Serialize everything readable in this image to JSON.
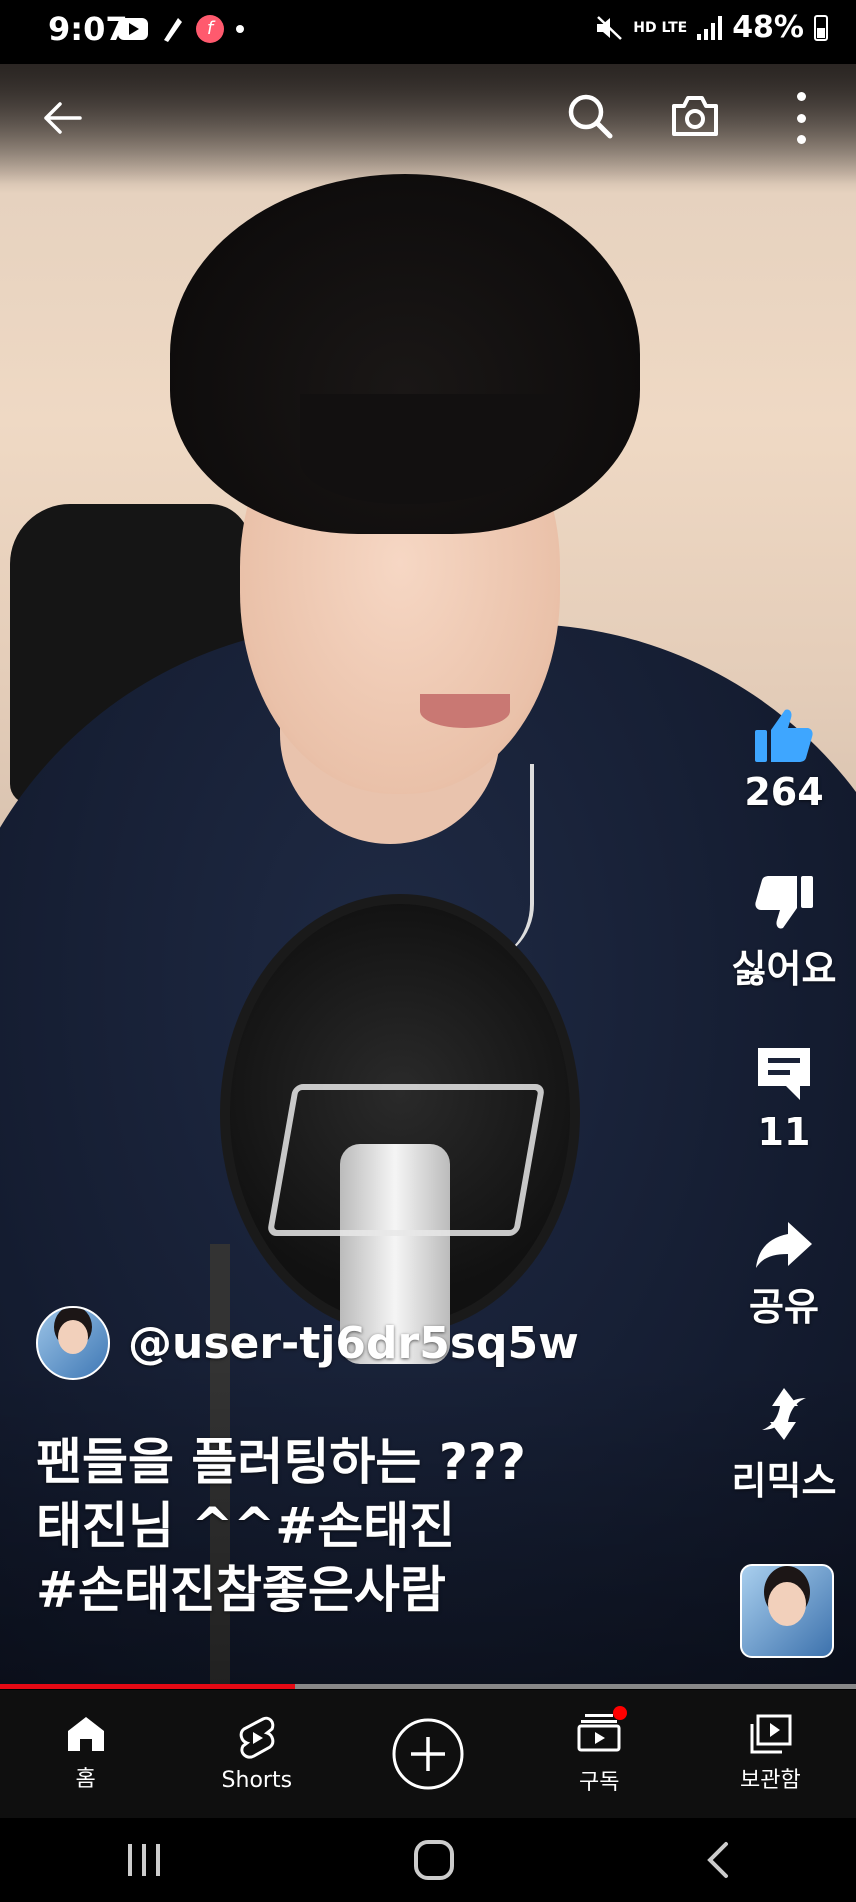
{
  "status_bar": {
    "time": "9:07",
    "network": "HD LTE",
    "battery": "48%",
    "icons_left": [
      "youtube-icon",
      "pen-icon",
      "f-app-icon",
      "dot"
    ],
    "icons_right": [
      "mute-icon",
      "hd-voice-lte-icon",
      "signal-icon",
      "battery-icon"
    ]
  },
  "video_controls": {
    "icons": [
      "back-arrow-icon",
      "search-icon",
      "camera-icon",
      "more-vert-icon"
    ]
  },
  "actions": {
    "like_count": "264",
    "dislike_label": "싫어요",
    "comment_count": "11",
    "share_label": "공유",
    "remix_label": "리믹스"
  },
  "channel": {
    "name": "@user-tj6dr5sq5w"
  },
  "caption": {
    "line1": "팬들을 플러팅하는 ???",
    "line2": "태진님 ^^#손태진",
    "line3": "#손태진참좋은사람"
  },
  "progress": {
    "played_fraction": 0.345
  },
  "bottom_nav": {
    "items": [
      {
        "label": "홈"
      },
      {
        "label": "Shorts"
      },
      {
        "label": ""
      },
      {
        "label": "구독"
      },
      {
        "label": "보관함"
      }
    ]
  },
  "colors": {
    "like_blue": "#3ea6ff",
    "progress_red": "#e50914",
    "nav_bg": "#0f0f0f"
  }
}
